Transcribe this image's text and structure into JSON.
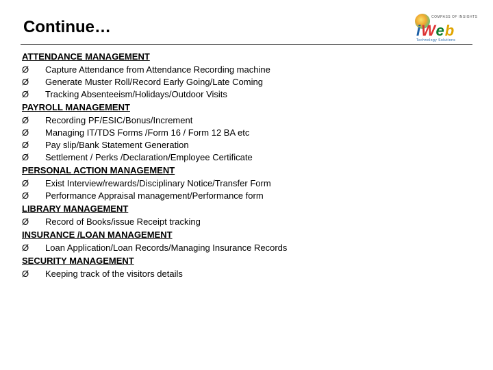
{
  "title": "Continue…",
  "logo": {
    "tagline": "COMPASS OF INSIGHTS",
    "brand_i": "i",
    "brand_w": "W",
    "brand_e": "e",
    "brand_b": "b",
    "subline": "Technology Solutions"
  },
  "sections": [
    {
      "heading": "ATTENDANCE MANAGEMENT",
      "items": [
        "Capture Attendance from Attendance Recording machine",
        "Generate Muster Roll/Record Early Going/Late Coming",
        "Tracking Absenteeism/Holidays/Outdoor Visits"
      ]
    },
    {
      "heading": "PAYROLL MANAGEMENT",
      "items": [
        "Recording PF/ESIC/Bonus/Increment",
        "Managing IT/TDS Forms /Form 16 / Form 12 BA etc",
        "Pay slip/Bank Statement Generation",
        "Settlement / Perks /Declaration/Employee Certificate"
      ]
    },
    {
      "heading": "PERSONAL ACTION MANAGEMENT",
      "items": [
        "Exist Interview/rewards/Disciplinary Notice/Transfer Form",
        "Performance Appraisal management/Performance form"
      ]
    },
    {
      "heading": "LIBRARY MANAGEMENT",
      "items": [
        "Record of Books/issue Receipt tracking"
      ]
    },
    {
      "heading": "INSURANCE /LOAN MANAGEMENT",
      "items": [
        "Loan Application/Loan Records/Managing Insurance Records"
      ]
    },
    {
      "heading": "SECURITY MANAGEMENT",
      "items": [
        "Keeping track of the visitors details"
      ]
    }
  ],
  "bullet_glyph": "Ø"
}
